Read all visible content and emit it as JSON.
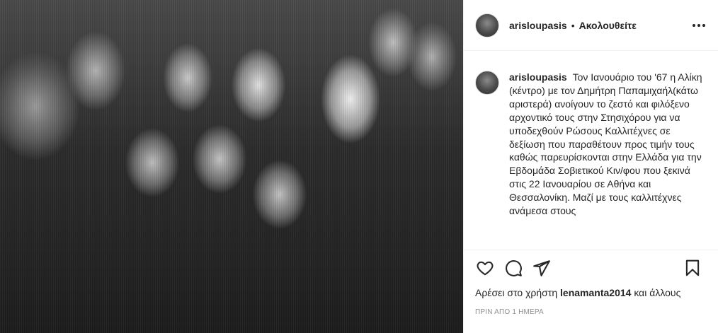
{
  "post": {
    "username": "arisloupasis",
    "separator": "•",
    "follow_status": "Ακολουθείτε",
    "caption": "Τον Ιανουάριο του '67 η Αλίκη (κέντρο) με τον Δημήτρη Παπαμιχαήλ(κάτω αριστερά) ανοίγουν το ζεστό και φιλόξενο αρχοντικό τους στην Στησιχόρου για να υποδεχθούν Ρώσους Καλλιτέχνες σε δεξίωση που παραθέτουν προς τιμήν τους καθώς παρευρίσκονται στην Ελλάδα για την Εβδομάδα Σοβιετικού Κιν/φου που ξεκινά στις 22 Ιανουαρίου σε Αθήνα και Θεσσαλονίκη. Μαζί με τους καλλιτέχνες ανάμεσα στους",
    "likes_prefix": "Αρέσει στο χρήστη ",
    "likes_user": "lenamanta2014",
    "likes_suffix": " και άλλους",
    "timestamp": "ΠΡΙΝ ΑΠΟ 1 ΗΜΕΡΑ"
  },
  "icons": {
    "like": "heart-icon",
    "comment": "comment-icon",
    "share": "share-icon",
    "save": "bookmark-icon",
    "more": "more-options-icon"
  },
  "colors": {
    "text": "#262626",
    "muted": "#8e8e8e",
    "border": "#efefef"
  }
}
